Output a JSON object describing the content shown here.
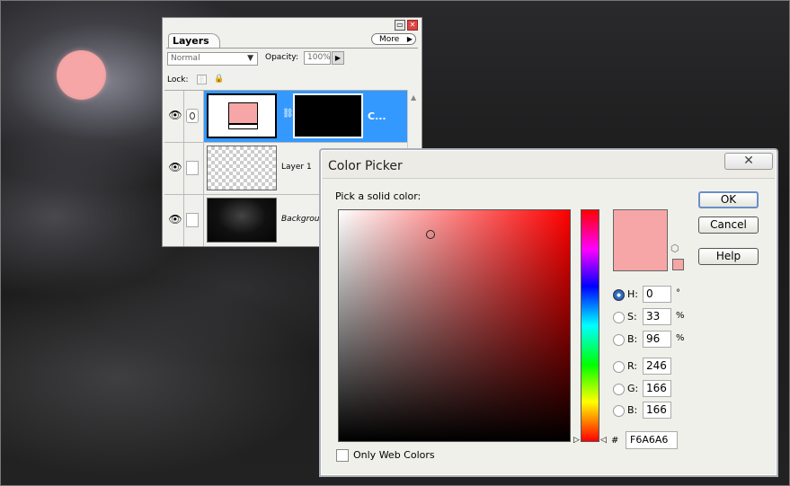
{
  "layers_panel": {
    "tab_label": "Layers",
    "more_label": "More",
    "blend_mode": "Normal",
    "opacity_label": "Opacity:",
    "opacity_value": "100%",
    "lock_label": "Lock:",
    "layers": [
      {
        "name": "C...",
        "visible": true,
        "selected": true,
        "type": "fill-with-mask"
      },
      {
        "name": "Layer 1",
        "visible": true,
        "selected": false,
        "type": "transparent"
      },
      {
        "name": "Backgrou",
        "visible": true,
        "selected": false,
        "type": "background"
      }
    ]
  },
  "color_picker": {
    "title": "Color Picker",
    "pick_label": "Pick a solid color:",
    "ok_label": "OK",
    "cancel_label": "Cancel",
    "help_label": "Help",
    "fields": {
      "h": {
        "label": "H:",
        "value": "0",
        "unit": "°",
        "selected": true
      },
      "s": {
        "label": "S:",
        "value": "33",
        "unit": "%"
      },
      "b_hsb": {
        "label": "B:",
        "value": "96",
        "unit": "%"
      },
      "r": {
        "label": "R:",
        "value": "246"
      },
      "g": {
        "label": "G:",
        "value": "166"
      },
      "b_rgb": {
        "label": "B:",
        "value": "166"
      }
    },
    "hex_label": "#",
    "hex_value": "F6A6A6",
    "only_web_colors_label": "Only Web Colors",
    "only_web_colors_checked": false,
    "current_color": "#f6a6a6"
  },
  "colors": {
    "selection_blue": "#3399ff",
    "fill_color": "#f6a6a6"
  }
}
